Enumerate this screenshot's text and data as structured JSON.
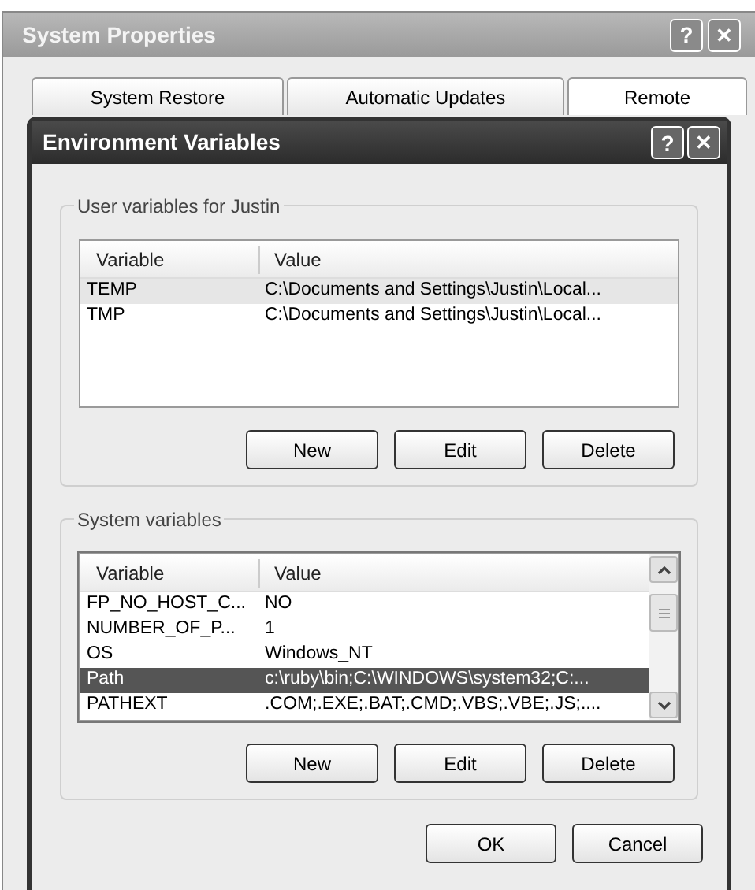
{
  "window": {
    "title": "System Properties",
    "help_glyph": "?",
    "close_glyph": "✕"
  },
  "tabs": [
    {
      "label": "System Restore",
      "selected": false
    },
    {
      "label": "Automatic Updates",
      "selected": false
    },
    {
      "label": "Remote",
      "selected": true
    }
  ],
  "dialog": {
    "title": "Environment Variables",
    "help_glyph": "?",
    "close_glyph": "✕",
    "groups": [
      {
        "label": "User variables for Justin",
        "focused": false,
        "scrollbar": false,
        "columns": [
          "Variable",
          "Value"
        ],
        "rows": [
          {
            "variable": "TEMP",
            "value": "C:\\Documents and Settings\\Justin\\Local...",
            "selected": true
          },
          {
            "variable": "TMP",
            "value": "C:\\Documents and Settings\\Justin\\Local...",
            "selected": false
          }
        ],
        "buttons": [
          "New",
          "Edit",
          "Delete"
        ]
      },
      {
        "label": "System variables",
        "focused": true,
        "scrollbar": true,
        "columns": [
          "Variable",
          "Value"
        ],
        "rows": [
          {
            "variable": "FP_NO_HOST_C...",
            "value": "NO",
            "selected": false
          },
          {
            "variable": "NUMBER_OF_P...",
            "value": "1",
            "selected": false
          },
          {
            "variable": "OS",
            "value": "Windows_NT",
            "selected": false
          },
          {
            "variable": "Path",
            "value": "c:\\ruby\\bin;C:\\WINDOWS\\system32;C:...",
            "selected": true
          },
          {
            "variable": "PATHEXT",
            "value": ".COM;.EXE;.BAT;.CMD;.VBS;.VBE;.JS;....",
            "selected": false
          }
        ],
        "buttons": [
          "New",
          "Edit",
          "Delete"
        ]
      }
    ],
    "buttons": [
      "OK",
      "Cancel"
    ]
  }
}
